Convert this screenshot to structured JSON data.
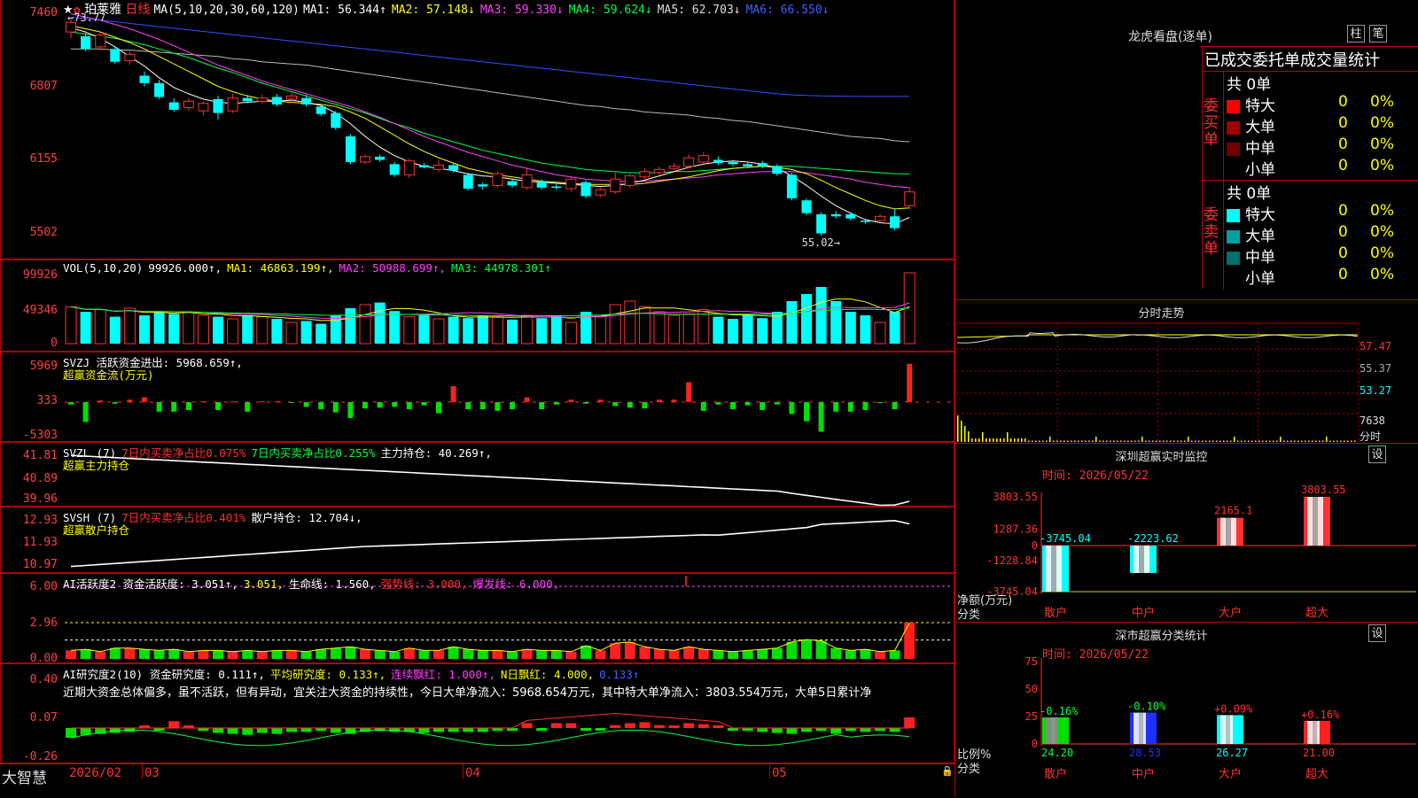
{
  "header": {
    "stock_name": "珀莱雅",
    "period": "日线",
    "ma_label": "MA(5,10,20,30,60,120)",
    "ma": [
      {
        "name": "MA1",
        "value": "56.344↑",
        "color": "#ffffff"
      },
      {
        "name": "MA2",
        "value": "57.148↓",
        "color": "#ffff00"
      },
      {
        "name": "MA3",
        "value": "59.330↓",
        "color": "#ff40ff"
      },
      {
        "name": "MA4",
        "value": "59.624↓",
        "color": "#00ff40"
      },
      {
        "name": "MA5",
        "value": "62.703↓",
        "color": "#dddddd"
      },
      {
        "name": "MA6",
        "value": "66.550↓",
        "color": "#4060ff"
      }
    ]
  },
  "main_chart": {
    "y_ticks": [
      "7460",
      "6807",
      "6155",
      "5502"
    ],
    "high_label": "←73.77",
    "low_label": "55.02→",
    "candles": [
      [
        72.6,
        73.5,
        72.0,
        73.77
      ],
      [
        72.2,
        71.0,
        70.8,
        72.5
      ],
      [
        71.2,
        72.3,
        70.9,
        72.6
      ],
      [
        71.0,
        69.8,
        69.6,
        71.3
      ],
      [
        69.9,
        70.5,
        69.5,
        70.8
      ],
      [
        68.5,
        67.8,
        67.5,
        68.9
      ],
      [
        67.8,
        66.5,
        66.3,
        68.1
      ],
      [
        66.0,
        65.3,
        65.1,
        66.4
      ],
      [
        65.5,
        66.1,
        65.2,
        66.4
      ],
      [
        65.2,
        65.9,
        64.8,
        66.1
      ],
      [
        66.3,
        65.0,
        64.4,
        66.6
      ],
      [
        65.2,
        66.4,
        65.0,
        66.8
      ],
      [
        66.4,
        66.1,
        65.9,
        66.7
      ],
      [
        66.1,
        66.4,
        65.9,
        66.7
      ],
      [
        66.5,
        65.8,
        65.6,
        66.8
      ],
      [
        66.3,
        66.6,
        66.0,
        67.0
      ],
      [
        66.4,
        65.8,
        65.6,
        66.7
      ],
      [
        65.6,
        64.9,
        64.7,
        65.8
      ],
      [
        65.0,
        63.6,
        63.4,
        65.2
      ],
      [
        62.8,
        60.4,
        60.2,
        63.0
      ],
      [
        60.4,
        60.9,
        60.2,
        61.1
      ],
      [
        60.9,
        60.6,
        60.4,
        61.1
      ],
      [
        60.2,
        59.2,
        59.0,
        60.4
      ],
      [
        59.2,
        60.5,
        58.9,
        60.7
      ],
      [
        60.1,
        59.9,
        59.8,
        60.3
      ],
      [
        59.7,
        60.1,
        59.5,
        60.6
      ],
      [
        60.1,
        59.6,
        59.4,
        60.3
      ],
      [
        59.2,
        57.9,
        57.7,
        59.4
      ],
      [
        58.3,
        58.1,
        57.8,
        58.5
      ],
      [
        58.2,
        59.3,
        58.0,
        59.5
      ],
      [
        58.6,
        58.2,
        58.0,
        58.8
      ],
      [
        58.0,
        59.2,
        57.8,
        59.9
      ],
      [
        58.6,
        58.0,
        57.8,
        58.8
      ],
      [
        58.1,
        58.0,
        57.8,
        58.3
      ],
      [
        57.9,
        58.8,
        57.6,
        59.0
      ],
      [
        58.5,
        57.2,
        57.0,
        58.7
      ],
      [
        57.3,
        57.8,
        57.1,
        58.0
      ],
      [
        57.6,
        58.8,
        57.4,
        59.5
      ],
      [
        58.2,
        59.1,
        58.0,
        59.3
      ],
      [
        59.0,
        59.5,
        58.8,
        59.8
      ],
      [
        59.4,
        59.7,
        59.2,
        60.0
      ],
      [
        59.8,
        60.0,
        59.6,
        60.3
      ],
      [
        60.0,
        60.8,
        59.8,
        61.1
      ],
      [
        60.4,
        61.0,
        60.2,
        61.3
      ],
      [
        60.6,
        60.3,
        60.1,
        60.9
      ],
      [
        60.4,
        60.2,
        60.0,
        60.6
      ],
      [
        60.2,
        60.0,
        59.8,
        60.4
      ],
      [
        60.3,
        60.0,
        59.8,
        60.5
      ],
      [
        60.0,
        59.3,
        59.1,
        60.2
      ],
      [
        59.2,
        57.0,
        56.8,
        59.4
      ],
      [
        56.8,
        55.6,
        55.4,
        57.0
      ],
      [
        55.5,
        53.7,
        53.5,
        55.7
      ],
      [
        55.5,
        55.3,
        55.1,
        55.8
      ],
      [
        55.5,
        55.1,
        54.9,
        55.7
      ],
      [
        54.9,
        54.8,
        54.6,
        55.1
      ],
      [
        54.9,
        55.3,
        54.7,
        55.5
      ],
      [
        55.3,
        54.2,
        54.0,
        56.0
      ],
      [
        56.3,
        57.6,
        56.0,
        58.0
      ]
    ],
    "ma_series": {
      "ma1": [
        73.0,
        72.6,
        72.0,
        71.2,
        70.3,
        69.4,
        68.3,
        67.4,
        66.8,
        66.3,
        66.0,
        65.9,
        66.0,
        66.1,
        66.1,
        66.2,
        66.0,
        65.7,
        65.0,
        64.0,
        62.8,
        61.8,
        61.0,
        60.4,
        60.0,
        59.8,
        59.6,
        59.3,
        59.1,
        59.0,
        58.8,
        58.6,
        58.5,
        58.4,
        58.3,
        58.2,
        58.1,
        58.2,
        58.4,
        58.7,
        59.1,
        59.5,
        59.9,
        60.2,
        60.4,
        60.5,
        60.4,
        60.2,
        59.8,
        59.1,
        58.2,
        57.2,
        56.3,
        55.6,
        55.0,
        54.7,
        54.6,
        55.2
      ],
      "ma2": [
        73.2,
        72.9,
        72.6,
        72.1,
        71.6,
        71.0,
        70.3,
        69.6,
        68.9,
        68.2,
        67.5,
        67.0,
        66.6,
        66.3,
        66.1,
        66.0,
        65.9,
        65.8,
        65.6,
        65.1,
        64.5,
        63.7,
        62.9,
        62.1,
        61.4,
        60.8,
        60.3,
        59.8,
        59.5,
        59.2,
        59.0,
        58.8,
        58.6,
        58.5,
        58.4,
        58.3,
        58.3,
        58.3,
        58.3,
        58.4,
        58.6,
        58.8,
        59.0,
        59.3,
        59.6,
        59.8,
        59.9,
        60.0,
        59.9,
        59.7,
        59.3,
        58.7,
        58.0,
        57.4,
        56.8,
        56.3,
        56.0,
        56.1
      ],
      "ma3": [
        74.3,
        74.0,
        73.7,
        73.3,
        72.9,
        72.4,
        71.9,
        71.3,
        70.7,
        70.1,
        69.5,
        69.0,
        68.5,
        68.0,
        67.6,
        67.2,
        66.8,
        66.4,
        66.0,
        65.6,
        65.1,
        64.6,
        64.0,
        63.4,
        62.8,
        62.3,
        61.8,
        61.3,
        60.9,
        60.5,
        60.1,
        59.8,
        59.5,
        59.2,
        59.0,
        58.8,
        58.7,
        58.6,
        58.6,
        58.6,
        58.7,
        58.8,
        58.9,
        59.0,
        59.2,
        59.3,
        59.4,
        59.5,
        59.5,
        59.5,
        59.4,
        59.2,
        59.0,
        58.8,
        58.5,
        58.3,
        58.1,
        58.0
      ],
      "ma4": [
        72.6,
        72.4,
        72.2,
        72.0,
        71.7,
        71.4,
        71.0,
        70.6,
        70.2,
        69.7,
        69.2,
        68.8,
        68.3,
        67.8,
        67.4,
        67.0,
        66.6,
        66.2,
        65.8,
        65.4,
        65.0,
        64.5,
        64.0,
        63.6,
        63.1,
        62.7,
        62.3,
        61.9,
        61.5,
        61.2,
        60.9,
        60.6,
        60.3,
        60.1,
        59.9,
        59.7,
        59.6,
        59.5,
        59.4,
        59.4,
        59.4,
        59.5,
        59.5,
        59.6,
        59.7,
        59.8,
        59.9,
        60.0,
        60.0,
        60.0,
        59.9,
        59.8,
        59.7,
        59.6,
        59.5,
        59.4,
        59.3,
        59.3
      ],
      "ma5": [
        71.0,
        71.0,
        71.0,
        70.9,
        70.9,
        70.8,
        70.7,
        70.6,
        70.5,
        70.4,
        70.3,
        70.1,
        70.0,
        69.8,
        69.7,
        69.6,
        69.5,
        69.3,
        69.1,
        68.9,
        68.7,
        68.5,
        68.3,
        68.1,
        67.9,
        67.7,
        67.5,
        67.3,
        67.1,
        66.9,
        66.7,
        66.5,
        66.3,
        66.1,
        65.9,
        65.7,
        65.6,
        65.4,
        65.3,
        65.1,
        65.0,
        64.9,
        64.8,
        64.6,
        64.5,
        64.3,
        64.2,
        64.0,
        63.8,
        63.6,
        63.4,
        63.2,
        63.0,
        62.8,
        62.7,
        62.6,
        62.4,
        62.3
      ],
      "ma6": [
        74.0,
        73.85,
        73.7,
        73.55,
        73.4,
        73.25,
        73.1,
        72.95,
        72.8,
        72.65,
        72.5,
        72.35,
        72.2,
        72.05,
        71.9,
        71.75,
        71.6,
        71.45,
        71.3,
        71.15,
        71.0,
        70.85,
        70.7,
        70.55,
        70.4,
        70.25,
        70.1,
        69.95,
        69.8,
        69.65,
        69.5,
        69.35,
        69.2,
        69.05,
        68.9,
        68.75,
        68.6,
        68.45,
        68.3,
        68.15,
        68.0,
        67.85,
        67.7,
        67.55,
        67.4,
        67.25,
        67.1,
        66.95,
        66.8,
        66.7,
        66.65,
        66.6,
        66.58,
        66.56,
        66.55,
        66.55,
        66.55,
        66.55
      ]
    }
  },
  "vol_panel": {
    "legend": [
      {
        "text": "VOL(5,10,20)",
        "color": "#ffffff"
      },
      {
        "text": "99926.000↑,",
        "color": "#ffffff"
      },
      {
        "text": "MA1: 46863.199↑,",
        "color": "#ffff00"
      },
      {
        "text": "MA2: 50988.699↑,",
        "color": "#ff40ff"
      },
      {
        "text": "MA3: 44978.301↑",
        "color": "#00ff40"
      }
    ],
    "y_ticks": [
      "99926",
      "49346",
      "0"
    ]
  },
  "svzj_panel": {
    "legend_line1": [
      {
        "text": "SVZJ  活跃资金进出: 5968.659↑,",
        "color": "#ffffff"
      }
    ],
    "legend_line2": "超赢资金流(万元)",
    "y_ticks": [
      "5969",
      "333",
      "-5303"
    ]
  },
  "svzl_panel": {
    "legend_line1": [
      {
        "text": "SVZL (7)",
        "color": "#ffffff"
      },
      {
        "text": "7日内买卖净占比0.075%",
        "color": "#ff3030"
      },
      {
        "text": "7日内买卖净占比0.255%",
        "color": "#00ff40"
      },
      {
        "text": "主力持仓: 40.269↑,",
        "color": "#ffffff"
      }
    ],
    "legend_line2": "超赢主力持仓",
    "y_ticks": [
      "41.81",
      "40.89",
      "39.96"
    ]
  },
  "svsh_panel": {
    "legend_line1": [
      {
        "text": "SVSH (7)",
        "color": "#ffffff"
      },
      {
        "text": "7日内买卖净占比0.401%",
        "color": "#ff3030"
      },
      {
        "text": "散户持仓: 12.704↓,",
        "color": "#ffffff"
      }
    ],
    "legend_line2": "超赢散户持仓",
    "y_ticks": [
      "12.93",
      "11.93",
      "10.97"
    ]
  },
  "ai_active_panel": {
    "legend_line1": [
      {
        "text": "AI活跃度2 资金活跃度: 3.051↑,",
        "color": "#ffffff"
      },
      {
        "text": "3.051,",
        "color": "#ffff00"
      },
      {
        "text": "生命线: 1.560,",
        "color": "#ffffff"
      },
      {
        "text": "强势线: 3.000,",
        "color": "#ff3030"
      },
      {
        "text": "爆发线: 6.000,",
        "color": "#ff40ff"
      }
    ],
    "y_ticks": [
      "6.00",
      "2.96",
      "0.00"
    ]
  },
  "ai_research_panel": {
    "legend_line1": [
      {
        "text": "AI研究度2(10) 资金研究度: 0.111↑,",
        "color": "#ffffff"
      },
      {
        "text": "平均研究度: 0.133↑,",
        "color": "#ffff00"
      },
      {
        "text": "连续飘红: 1.000↑,",
        "color": "#ff40ff"
      },
      {
        "text": "N日飘红: 4.000,",
        "color": "#ffff00"
      },
      {
        "text": "0.133↑",
        "color": "#4060ff"
      }
    ],
    "commentary": "近期大资金总体偏多，虽不活跃，但有异动，宜关注大资金的持续性，今日大单净流入：5968.654万元，其中特大单净流入：3803.554万元，大单5日累计净",
    "y_ticks": [
      "0.40",
      "0.07",
      "-0.26"
    ]
  },
  "x_axis": {
    "labels": [
      "2026/02",
      "03",
      "04",
      "05"
    ]
  },
  "bottom_left": {
    "logo_text": "大智慧"
  },
  "right_panel": {
    "lhb": {
      "title": "龙虎看盘(逐单)",
      "btn_pillar": "柱",
      "btn_pen": "笔"
    },
    "order_stats": {
      "header": "已成交委托单成交量统计",
      "buy_label": "委买单",
      "sell_label": "委卖单",
      "buy_total": "共 0单",
      "sell_total": "共 0单",
      "buy_rows": [
        {
          "name": "特大",
          "val": "0",
          "pct": "0%",
          "color": "#ff0000"
        },
        {
          "name": "大单",
          "val": "0",
          "pct": "0%",
          "color": "#a00000"
        },
        {
          "name": "中单",
          "val": "0",
          "pct": "0%",
          "color": "#700000"
        },
        {
          "name": "小单",
          "val": "0",
          "pct": "0%",
          "color": ""
        }
      ],
      "sell_rows": [
        {
          "name": "特大",
          "val": "0",
          "pct": "0%",
          "color": "#00ffff"
        },
        {
          "name": "大单",
          "val": "0",
          "pct": "0%",
          "color": "#00a0a0"
        },
        {
          "name": "中单",
          "val": "0",
          "pct": "0%",
          "color": "#007070"
        },
        {
          "name": "小单",
          "val": "0",
          "pct": "0%",
          "color": ""
        }
      ]
    },
    "intraday": {
      "title": "分时走势",
      "prices": [
        "57.47",
        "55.37",
        "53.27"
      ],
      "vol_top": "7638",
      "vol_unit": "分时"
    },
    "sz_monitor": {
      "title": "深圳超赢实时监控",
      "btn": "设",
      "date": "时间: 2026/05/22",
      "y_ticks": [
        "3803.55",
        "1287.36",
        "0",
        "-1228.84",
        "-3745.04"
      ],
      "ylabel": "净额(万元)",
      "xlabel": "分类",
      "categories": [
        "散户",
        "中户",
        "大户",
        "超大"
      ],
      "values": [
        -3745.04,
        -2223.62,
        2165.1,
        3803.55
      ],
      "value_labels": [
        "-3745.04",
        "-2223.62",
        "2165.1",
        "3803.55"
      ]
    },
    "sz_class": {
      "title": "深市超赢分类统计",
      "btn": "设",
      "date": "时间: 2026/05/22",
      "y_ticks": [
        "75",
        "50",
        "25",
        "0"
      ],
      "ylabel": "比例%",
      "xlabel": "分类",
      "categories": [
        "散户",
        "中户",
        "大户",
        "超大"
      ],
      "values": [
        24.2,
        28.53,
        26.27,
        21.0
      ],
      "deltas": [
        "-0.16%",
        "-0.10%",
        "+0.09%",
        "+0.16%"
      ],
      "value_labels": [
        "24.20",
        "28.53",
        "26.27",
        "21.00"
      ]
    }
  }
}
